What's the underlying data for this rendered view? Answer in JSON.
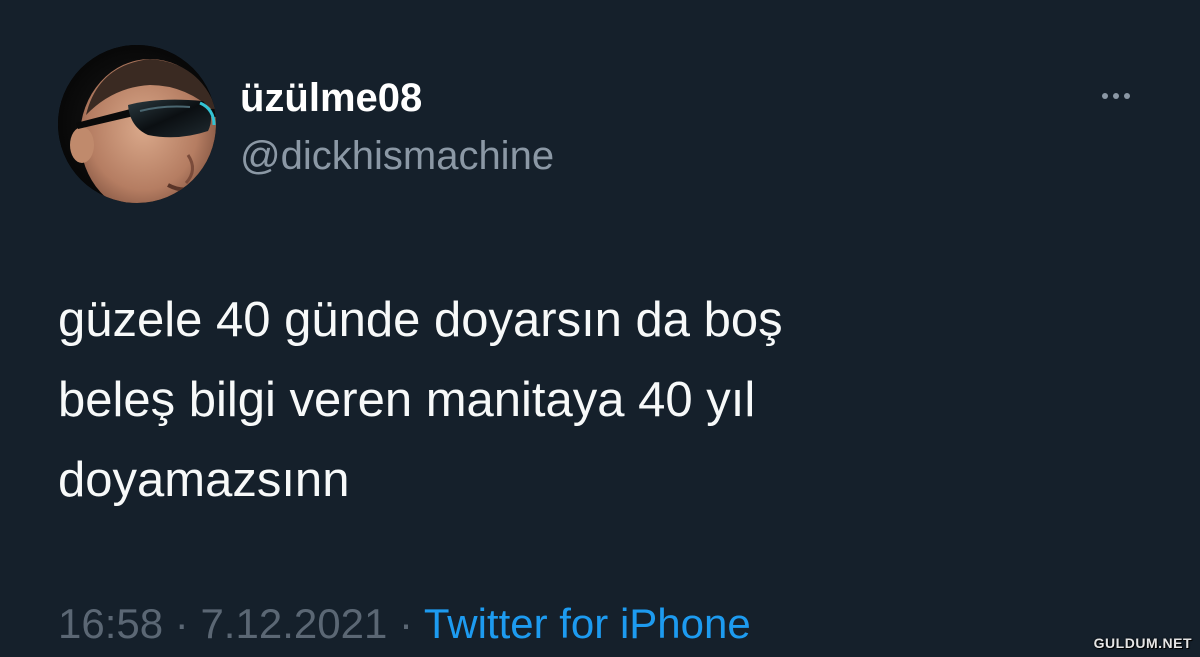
{
  "tweet": {
    "display_name": "üzülme08",
    "handle": "@dickhismachine",
    "text_lines": [
      "güzele 40 günde doyarsın da boş",
      "beleş bilgi veren manitaya 40 yıl",
      "doyamazsınn"
    ],
    "time": "16:58",
    "separator": "·",
    "date": "7.12.2021",
    "source": "Twitter for iPhone",
    "more_icon": "more-horizontal-icon"
  },
  "watermark": "GULDUM.NET",
  "colors": {
    "background": "#15202b",
    "text": "#f7f9f9",
    "secondary": "#8b98a5",
    "accent": "#1d9bf0"
  }
}
